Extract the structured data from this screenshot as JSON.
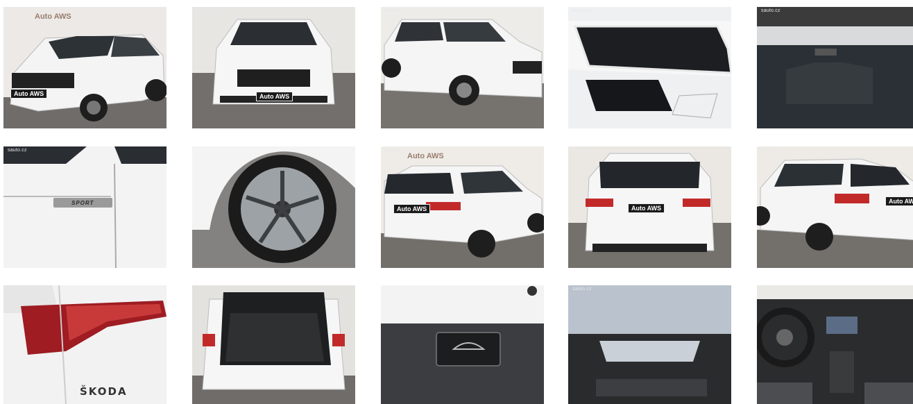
{
  "gallery": {
    "watermark": "sauto.cz",
    "brand_text": "Auto AWS",
    "badge_text": "SPORT",
    "maker_text": "ŠKODA",
    "photos": [
      {
        "subject": "front-three-quarter-view"
      },
      {
        "subject": "front-view"
      },
      {
        "subject": "side-front-view"
      },
      {
        "subject": "headlight-closeup"
      },
      {
        "subject": "windshield-interior"
      },
      {
        "subject": "door-sport-badge"
      },
      {
        "subject": "alloy-wheel"
      },
      {
        "subject": "rear-three-quarter-view"
      },
      {
        "subject": "rear-view"
      },
      {
        "subject": "rear-side-view"
      },
      {
        "subject": "taillight-closeup"
      },
      {
        "subject": "open-trunk"
      },
      {
        "subject": "trunk-button"
      },
      {
        "subject": "panoramic-roof"
      },
      {
        "subject": "dashboard-interior"
      }
    ]
  }
}
